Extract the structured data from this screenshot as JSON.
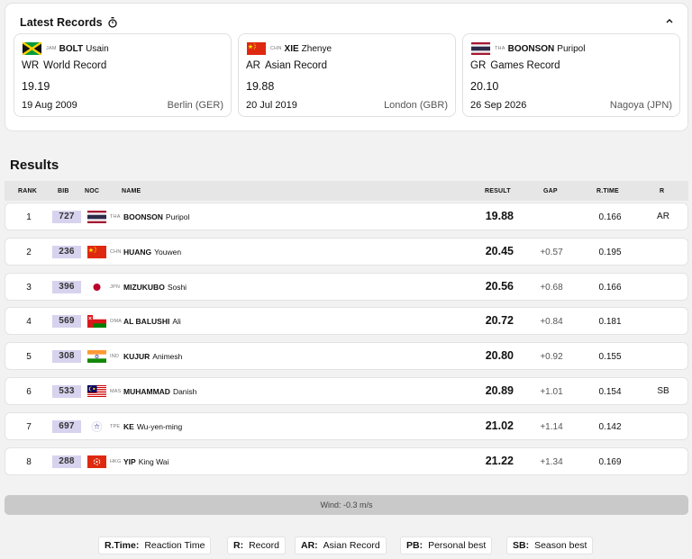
{
  "records": {
    "title": "Latest Records",
    "cards": [
      {
        "noc": "JAM",
        "surname": "BOLT",
        "given": "Usain",
        "abbr": "WR",
        "label": "World Record",
        "time": "19.19",
        "date": "19 Aug 2009",
        "venue": "Berlin (GER)",
        "flag": "jam-flag"
      },
      {
        "noc": "CHN",
        "surname": "XIE",
        "given": "Zhenye",
        "abbr": "AR",
        "label": "Asian Record",
        "time": "19.88",
        "date": "20 Jul 2019",
        "venue": "London (GBR)",
        "flag": "chn-flag"
      },
      {
        "noc": "THA",
        "surname": "BOONSON",
        "given": "Puripol",
        "abbr": "GR",
        "label": "Games Record",
        "time": "20.10",
        "date": "26 Sep 2026",
        "venue": "Nagoya (JPN)",
        "flag": "tha-flag"
      }
    ]
  },
  "results": {
    "title": "Results",
    "headers": {
      "rank": "RANK",
      "bib": "BIB",
      "noc": "NOC",
      "name": "NAME",
      "result": "RESULT",
      "gap": "GAP",
      "rtime": "R.TIME",
      "r": "R"
    },
    "rows": [
      {
        "rank": "1",
        "bib": "727",
        "noc": "THA",
        "surname": "BOONSON",
        "given": "Puripol",
        "result": "19.88",
        "gap": "",
        "rtime": "0.166",
        "r": "AR",
        "flag": "tha-flag"
      },
      {
        "rank": "2",
        "bib": "236",
        "noc": "CHN",
        "surname": "HUANG",
        "given": "Youwen",
        "result": "20.45",
        "gap": "+0.57",
        "rtime": "0.195",
        "r": "",
        "flag": "chn-flag"
      },
      {
        "rank": "3",
        "bib": "396",
        "noc": "JPN",
        "surname": "MIZUKUBO",
        "given": "Soshi",
        "result": "20.56",
        "gap": "+0.68",
        "rtime": "0.166",
        "r": "",
        "flag": "jpn-flag"
      },
      {
        "rank": "4",
        "bib": "569",
        "noc": "OMA",
        "surname": "AL BALUSHI",
        "given": "Ali",
        "result": "20.72",
        "gap": "+0.84",
        "rtime": "0.181",
        "r": "",
        "flag": "oma-flag"
      },
      {
        "rank": "5",
        "bib": "308",
        "noc": "IND",
        "surname": "KUJUR",
        "given": "Animesh",
        "result": "20.80",
        "gap": "+0.92",
        "rtime": "0.155",
        "r": "",
        "flag": "ind-flag"
      },
      {
        "rank": "6",
        "bib": "533",
        "noc": "MAS",
        "surname": "MUHAMMAD",
        "given": "Danish",
        "result": "20.89",
        "gap": "+1.01",
        "rtime": "0.154",
        "r": "SB",
        "flag": "mas-flag"
      },
      {
        "rank": "7",
        "bib": "697",
        "noc": "TPE",
        "surname": "KE",
        "given": "Wu-yen-ming",
        "result": "21.02",
        "gap": "+1.14",
        "rtime": "0.142",
        "r": "",
        "flag": "tpe-flag"
      },
      {
        "rank": "8",
        "bib": "288",
        "noc": "HKG",
        "surname": "YIP",
        "given": "King Wai",
        "result": "21.22",
        "gap": "+1.34",
        "rtime": "0.169",
        "r": "",
        "flag": "hkg-flag"
      }
    ]
  },
  "wind": "Wind: -0.3 m/s",
  "legend": [
    {
      "key": "R.Time:",
      "value": "Reaction Time"
    },
    {
      "key": "R:",
      "value": "Record"
    },
    {
      "key": "AR:",
      "value": "Asian Record"
    },
    {
      "key": "PB:",
      "value": "Personal best"
    },
    {
      "key": "SB:",
      "value": "Season best"
    }
  ],
  "colors": {
    "bib_bg": "#d7d3ee",
    "wind_bg": "#c9c9c9",
    "header_bg": "#e6e6e6"
  }
}
